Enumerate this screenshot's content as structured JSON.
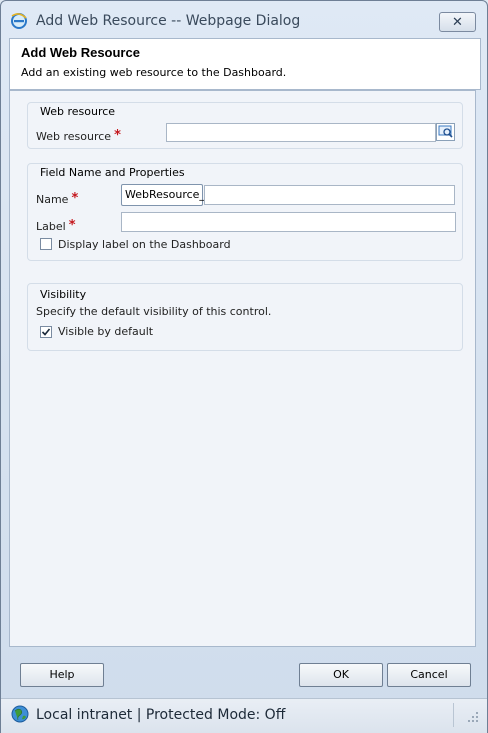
{
  "window": {
    "title": "Add Web Resource -- Webpage Dialog",
    "close_symbol": "✕"
  },
  "header": {
    "title": "Add Web Resource",
    "description": "Add an existing web resource to the Dashboard."
  },
  "web_resource_section": {
    "title": "Web resource",
    "field_label": "Web resource",
    "required_mark": "*",
    "value": ""
  },
  "field_section": {
    "title": "Field Name and Properties",
    "name_label": "Name",
    "name_prefix": "WebResource_",
    "name_value": "",
    "label_label": "Label",
    "label_value": "",
    "required_mark": "*",
    "display_label_text": "Display label on the Dashboard",
    "display_label_checked": false
  },
  "visibility_section": {
    "title": "Visibility",
    "description": "Specify the default visibility of this control.",
    "visible_text": "Visible by default",
    "visible_checked": true
  },
  "footer": {
    "help_label": "Help",
    "ok_label": "OK",
    "cancel_label": "Cancel"
  },
  "statusbar": {
    "text": "Local intranet | Protected Mode: Off"
  },
  "colors": {
    "required": "#c4161c",
    "accent": "#1f6fbf"
  }
}
